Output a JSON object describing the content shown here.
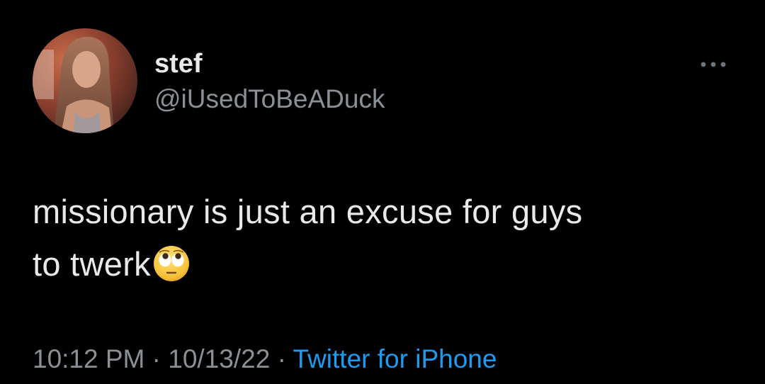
{
  "tweet": {
    "author": {
      "display_name": "stef",
      "handle": "@iUsedToBeADuck"
    },
    "text_line_1": "missionary is just an excuse for guys",
    "text_line_2": "to twerk",
    "emoji": "face-with-rolling-eyes",
    "time": "10:12 PM",
    "separator": "·",
    "date": "10/13/22",
    "source": "Twitter for iPhone"
  },
  "colors": {
    "background": "#000000",
    "text_primary": "#e7e9ea",
    "text_secondary": "#8b9096",
    "link": "#1d9bf0"
  },
  "icons": {
    "more": "more-horizontal-icon",
    "avatar": "avatar"
  }
}
